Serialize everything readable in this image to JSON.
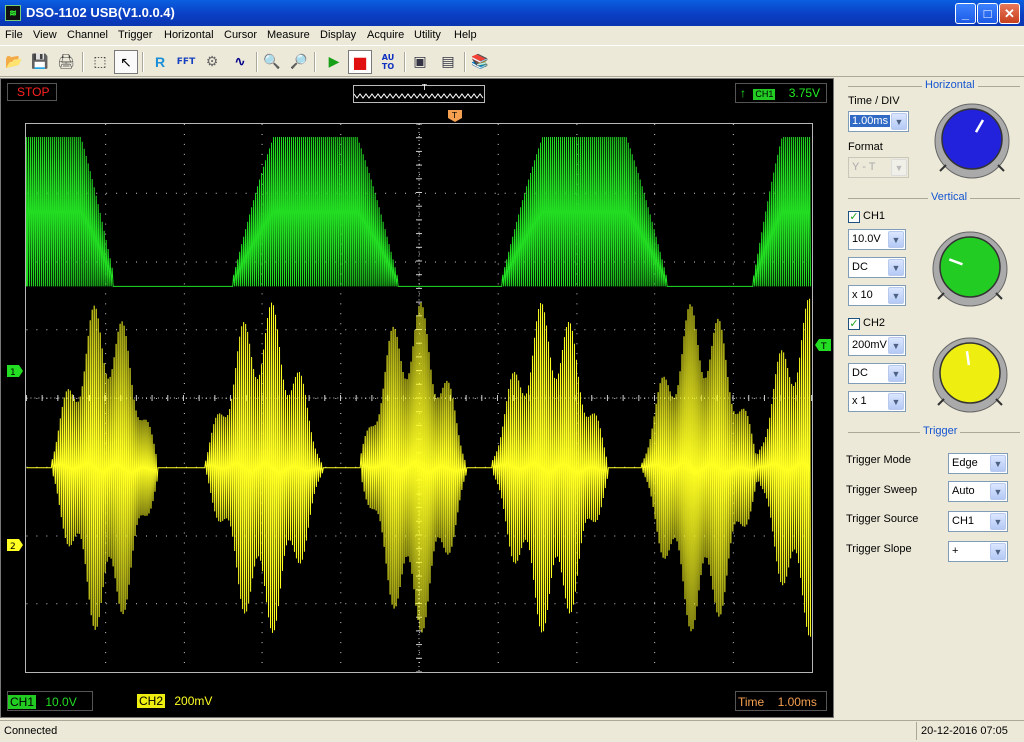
{
  "window": {
    "title": "DSO-1102 USB(V1.0.0.4)",
    "icon_glyph": "≋",
    "buttons": {
      "minimize": "_",
      "maximize": "□",
      "close": "✕"
    }
  },
  "menu": [
    "File",
    "View",
    "Channel",
    "Trigger",
    "Horizontal",
    "Cursor",
    "Measure",
    "Display",
    "Acquire",
    "Utility",
    "Help"
  ],
  "toolbar": {
    "open": "📂",
    "save": "💾",
    "print": "🖨",
    "select": "⬚",
    "pointer": "↖",
    "ref_label": "R",
    "fft_label": "FFT",
    "settings": "⚙",
    "wave": "∿",
    "zoom_in": "🔍",
    "zoom_out": "🔎",
    "run": "▶",
    "stop": "■",
    "auto_label": "AU TO",
    "screen": "▣",
    "window": "▤",
    "book": "📚"
  },
  "scope": {
    "run_state": "STOP",
    "trigger_view_marker": "T",
    "trigger_source_badge": "CH1",
    "trigger_level": "3.75V",
    "trigger_edge_glyph": "↑",
    "ch1_marker": "1",
    "ch2_marker": "2",
    "trigger_level_marker": "T",
    "trigger_pos_marker": "T",
    "ch1_scale_label": "CH1",
    "ch1_scale": "10.0V",
    "ch2_scale_label": "CH2",
    "ch2_scale": "200mV",
    "time_label": "Time",
    "time_value": "1.00ms",
    "colors": {
      "ch1": "#22dd22",
      "ch2": "#ffff22",
      "stop": "#ff2222",
      "grid": "#d0d0d0"
    }
  },
  "horizontal": {
    "title": "Horizontal",
    "time_div_label": "Time / DIV",
    "time_div_value": "1.00ms",
    "format_label": "Format",
    "format_value": "Y - T",
    "knob_color": "#2222dd"
  },
  "vertical": {
    "title": "Vertical",
    "ch1": {
      "label": "CH1",
      "enabled": true,
      "volts": "10.0V",
      "coupling": "DC",
      "probe": "x 10",
      "knob_color": "#22cc22"
    },
    "ch2": {
      "label": "CH2",
      "enabled": true,
      "volts": "200mV",
      "coupling": "DC",
      "probe": "x 1",
      "knob_color": "#eeee10"
    },
    "check_glyph": "✓"
  },
  "trigger": {
    "title": "Trigger",
    "mode_label": "Trigger Mode",
    "mode_value": "Edge",
    "sweep_label": "Trigger Sweep",
    "sweep_value": "Auto",
    "source_label": "Trigger Source",
    "source_value": "CH1",
    "slope_label": "Trigger Slope",
    "slope_value": "+"
  },
  "statusbar": {
    "status": "Connected",
    "datetime": "20-12-2016  07:05"
  },
  "dropdown_glyph": "▼"
}
